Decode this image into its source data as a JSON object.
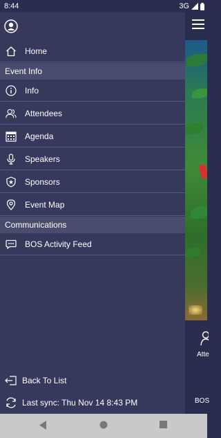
{
  "status_bar": {
    "time": "8:44",
    "network": "3G"
  },
  "menu": {
    "home": "Home",
    "section_event_info": "Event Info",
    "info": "Info",
    "attendees": "Attendees",
    "agenda": "Agenda",
    "speakers": "Speakers",
    "sponsors": "Sponsors",
    "event_map": "Event Map",
    "section_communications": "Communications",
    "activity_feed": "BOS Activity Feed"
  },
  "footer": {
    "back_to_list": "Back To List",
    "last_sync": "Last sync: Thu Nov 14 8:43 PM"
  },
  "background_screen": {
    "tile_label": "Atte",
    "bottom_label": "BOS"
  },
  "colors": {
    "drawer_bg": "#37395c",
    "section_bg": "#4a4c6e",
    "app_bg": "#2b2d4f",
    "nav_bar_bg": "#c9c9c9"
  }
}
